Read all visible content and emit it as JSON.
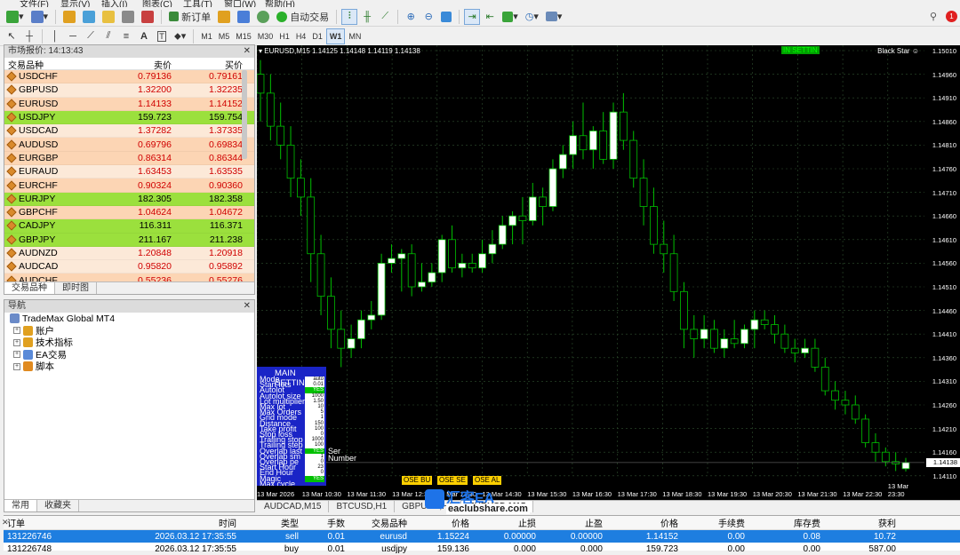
{
  "menu": [
    "文件(F)",
    "显示(V)",
    "插入(I)",
    "图表(C)",
    "工具(T)",
    "窗口(W)",
    "帮助(H)"
  ],
  "toolbar": {
    "new_order": "新订单",
    "auto_trade": "自动交易",
    "timeframes": [
      "M1",
      "M5",
      "M15",
      "M30",
      "H1",
      "H4",
      "D1",
      "W1",
      "MN"
    ],
    "active_timeframe": "M15",
    "pressed_timeframe": "W1"
  },
  "market_watch": {
    "title": "市场报价: 14:13:43",
    "col_symbol": "交易品种",
    "col_bid": "卖价",
    "col_ask": "买价",
    "rows": [
      {
        "symbol": "USDCHF",
        "bid": "0.79136",
        "ask": "0.79161",
        "bg": "#fcd5b4"
      },
      {
        "symbol": "GBPUSD",
        "bid": "1.32200",
        "ask": "1.32235",
        "bg": "#fce9d8"
      },
      {
        "symbol": "EURUSD",
        "bid": "1.14133",
        "ask": "1.14152",
        "bg": "#fcd5b4"
      },
      {
        "symbol": "USDJPY",
        "bid": "159.723",
        "ask": "159.754",
        "bg": "#9be03d",
        "green": true
      },
      {
        "symbol": "USDCAD",
        "bid": "1.37282",
        "ask": "1.37335",
        "bg": "#fce9d8"
      },
      {
        "symbol": "AUDUSD",
        "bid": "0.69796",
        "ask": "0.69834",
        "bg": "#fcd5b4"
      },
      {
        "symbol": "EURGBP",
        "bid": "0.86314",
        "ask": "0.86344",
        "bg": "#fcd5b4"
      },
      {
        "symbol": "EURAUD",
        "bid": "1.63453",
        "ask": "1.63535",
        "bg": "#fce9d8"
      },
      {
        "symbol": "EURCHF",
        "bid": "0.90324",
        "ask": "0.90360",
        "bg": "#fcd5b4"
      },
      {
        "symbol": "EURJPY",
        "bid": "182.305",
        "ask": "182.358",
        "bg": "#9be03d",
        "green": true
      },
      {
        "symbol": "GBPCHF",
        "bid": "1.04624",
        "ask": "1.04672",
        "bg": "#fcd5b4"
      },
      {
        "symbol": "CADJPY",
        "bid": "116.311",
        "ask": "116.371",
        "bg": "#9be03d",
        "green": true
      },
      {
        "symbol": "GBPJPY",
        "bid": "211.167",
        "ask": "211.238",
        "bg": "#9be03d",
        "green": true
      },
      {
        "symbol": "AUDNZD",
        "bid": "1.20848",
        "ask": "1.20918",
        "bg": "#fce9d8"
      },
      {
        "symbol": "AUDCAD",
        "bid": "0.95820",
        "ask": "0.95892",
        "bg": "#fce9d8"
      },
      {
        "symbol": "AUDCHF",
        "bid": "0.55236",
        "ask": "0.55276",
        "bg": "#fcd5b4"
      }
    ],
    "tabs": [
      "交易品种",
      "即时图"
    ]
  },
  "navigator": {
    "title": "导航",
    "root": "TradeMax Global MT4",
    "items": [
      "账户",
      "技术指标",
      "EA交易",
      "脚本"
    ],
    "tabs": [
      "常用",
      "收藏夹"
    ]
  },
  "chart": {
    "title": "EURUSD,M15  1.14125 1.14148 1.14119 1.14138",
    "indicator": "Black Star",
    "in_setting": "IN SETTIN",
    "price_labels": [
      "1.15010",
      "1.14960",
      "1.14910",
      "1.14860",
      "1.14810",
      "1.14760",
      "1.14710",
      "1.14660",
      "1.14610",
      "1.14560",
      "1.14510",
      "1.14460",
      "1.14410",
      "1.14360",
      "1.14310",
      "1.14260",
      "1.14210",
      "1.14160",
      "1.14110"
    ],
    "current_price": "1.14138",
    "time_labels": [
      "13 Mar 2026",
      "13 Mar 10:30",
      "13 Mar 11:30",
      "13 Mar 12:30",
      "13 Mar 13:30",
      "13 Mar 14:30",
      "13 Mar 15:30",
      "13 Mar 16:30",
      "13 Mar 17:30",
      "13 Mar 18:30",
      "13 Mar 19:30",
      "13 Mar 20:30",
      "13 Mar 21:30",
      "13 Mar 22:30",
      "13 Mar 23:30"
    ],
    "colors": {
      "bull": "#ffffff",
      "bear": "#000000",
      "wick": "#00c000",
      "grid": "#1a3a1a"
    },
    "candles": [
      [
        1.1496,
        1.1499,
        1.1486,
        1.1492
      ],
      [
        1.1492,
        1.1496,
        1.1482,
        1.1485
      ],
      [
        1.1485,
        1.149,
        1.1478,
        1.1481
      ],
      [
        1.1481,
        1.1485,
        1.147,
        1.1474
      ],
      [
        1.1474,
        1.1478,
        1.1466,
        1.147
      ],
      [
        1.147,
        1.1474,
        1.1452,
        1.1458
      ],
      [
        1.1458,
        1.1462,
        1.1445,
        1.1449
      ],
      [
        1.1449,
        1.1453,
        1.1438,
        1.1442
      ],
      [
        1.1442,
        1.1446,
        1.1434,
        1.1438
      ],
      [
        1.1438,
        1.1443,
        1.1436,
        1.144
      ],
      [
        1.144,
        1.1446,
        1.1438,
        1.1444
      ],
      [
        1.1444,
        1.1448,
        1.1442,
        1.1445
      ],
      [
        1.1445,
        1.1458,
        1.1444,
        1.1456
      ],
      [
        1.1456,
        1.146,
        1.1454,
        1.1457
      ],
      [
        1.1457,
        1.1459,
        1.145,
        1.1458
      ],
      [
        1.1458,
        1.146,
        1.1449,
        1.1451
      ],
      [
        1.1451,
        1.1456,
        1.145,
        1.1452
      ],
      [
        1.1452,
        1.1456,
        1.1451,
        1.1454
      ],
      [
        1.1454,
        1.1462,
        1.1452,
        1.1461
      ],
      [
        1.1461,
        1.1464,
        1.1454,
        1.1455
      ],
      [
        1.1455,
        1.1458,
        1.1453,
        1.1456
      ],
      [
        1.1456,
        1.1458,
        1.1454,
        1.1455
      ],
      [
        1.1455,
        1.1461,
        1.1454,
        1.1458
      ],
      [
        1.1458,
        1.1463,
        1.1456,
        1.146
      ],
      [
        1.146,
        1.1466,
        1.1459,
        1.1464
      ],
      [
        1.1464,
        1.1467,
        1.146,
        1.1466
      ],
      [
        1.1466,
        1.147,
        1.146,
        1.1465
      ],
      [
        1.1465,
        1.1473,
        1.1464,
        1.147
      ],
      [
        1.147,
        1.1472,
        1.1464,
        1.1468
      ],
      [
        1.1468,
        1.1478,
        1.1467,
        1.1476
      ],
      [
        1.1476,
        1.1481,
        1.1474,
        1.1479
      ],
      [
        1.1479,
        1.1486,
        1.1476,
        1.1483
      ],
      [
        1.1483,
        1.149,
        1.1478,
        1.148
      ],
      [
        1.148,
        1.1485,
        1.1476,
        1.1484
      ],
      [
        1.1484,
        1.1488,
        1.1477,
        1.1478
      ],
      [
        1.1478,
        1.149,
        1.1476,
        1.1488
      ],
      [
        1.1488,
        1.1492,
        1.148,
        1.1482
      ],
      [
        1.1482,
        1.1484,
        1.1472,
        1.1474
      ],
      [
        1.1474,
        1.1478,
        1.1464,
        1.1468
      ],
      [
        1.1468,
        1.1472,
        1.1458,
        1.146
      ],
      [
        1.146,
        1.1465,
        1.1454,
        1.1458
      ],
      [
        1.1458,
        1.1462,
        1.1448,
        1.145
      ],
      [
        1.145,
        1.1452,
        1.1438,
        1.1442
      ],
      [
        1.1442,
        1.1445,
        1.1436,
        1.144
      ],
      [
        1.144,
        1.1445,
        1.1438,
        1.1442
      ],
      [
        1.1442,
        1.1444,
        1.1437,
        1.1438
      ],
      [
        1.1438,
        1.1442,
        1.1436,
        1.144
      ],
      [
        1.144,
        1.1444,
        1.1438,
        1.1439
      ],
      [
        1.1439,
        1.1443,
        1.1438,
        1.1442
      ],
      [
        1.1442,
        1.1446,
        1.1438,
        1.1444
      ],
      [
        1.1444,
        1.1446,
        1.1442,
        1.1443
      ],
      [
        1.1443,
        1.1445,
        1.1439,
        1.1441
      ],
      [
        1.1441,
        1.1443,
        1.1437,
        1.1438
      ],
      [
        1.1438,
        1.144,
        1.1435,
        1.1437
      ],
      [
        1.1437,
        1.144,
        1.1436,
        1.1438
      ],
      [
        1.1438,
        1.144,
        1.1433,
        1.1434
      ],
      [
        1.1434,
        1.1436,
        1.1428,
        1.1429
      ],
      [
        1.1429,
        1.1431,
        1.1425,
        1.1427
      ],
      [
        1.1427,
        1.1429,
        1.1424,
        1.1426
      ],
      [
        1.1426,
        1.1428,
        1.1422,
        1.1423
      ],
      [
        1.1423,
        1.1424,
        1.1417,
        1.1418
      ],
      [
        1.1418,
        1.142,
        1.1414,
        1.1416
      ],
      [
        1.1416,
        1.1417,
        1.1413,
        1.1414
      ],
      [
        1.1414,
        1.1416,
        1.1412,
        1.14135
      ],
      [
        1.14125,
        1.14148,
        1.14119,
        1.14138
      ]
    ]
  },
  "ea_panel": {
    "heading": "MAIN SETTINGS",
    "rows": [
      {
        "label": "Mode",
        "value": "auto",
        "green": false
      },
      {
        "label": "Start lots",
        "value": "0.01",
        "green": false
      },
      {
        "label": "Autolot",
        "value": "YES",
        "green": true
      },
      {
        "label": "Autolot size",
        "value": "1000",
        "green": false
      },
      {
        "label": "Lot multiplier",
        "value": "1.50",
        "green": false
      },
      {
        "label": "Max lot",
        "value": "10",
        "green": false
      },
      {
        "label": "Max Orders",
        "value": "5",
        "green": false
      },
      {
        "label": "Grid mode",
        "value": "1",
        "green": false
      },
      {
        "label": "Distance",
        "value": "150",
        "green": false
      },
      {
        "label": "Take profit",
        "value": "100",
        "green": false
      },
      {
        "label": "Stop loss",
        "value": "0",
        "green": false
      },
      {
        "label": "Trailing stop",
        "value": "1000",
        "green": false
      },
      {
        "label": "Trailing step",
        "value": "100",
        "green": false
      },
      {
        "label": "Overlap last",
        "value": "YES",
        "green": true
      },
      {
        "label": "Overlap sm",
        "value": "1",
        "green": false
      },
      {
        "label": "Overlap pe",
        "value": "0",
        "green": false
      },
      {
        "label": "Start Hour",
        "value": "23",
        "green": false
      },
      {
        "label": "End Hour",
        "value": "0",
        "green": false
      },
      {
        "label": "Magic",
        "value": "YES",
        "green": true
      },
      {
        "label": "Max cycle",
        "value": "",
        "green": false
      }
    ],
    "overlap_text_1": "Ser",
    "overlap_text_2": "Number",
    "buttons": [
      "OSE BU",
      "OSE SE",
      "OSE AL"
    ]
  },
  "chart_tabs": [
    "AUDCAD,M15",
    "BTCUSD,H1",
    "GBPUSD,H1",
    "EURUSD,M15"
  ],
  "watermark": {
    "cn": "汇客EA",
    "en": "eaclubshare.com"
  },
  "terminal": {
    "headers": [
      "订单",
      "时间",
      "类型",
      "手数",
      "交易品种",
      "价格",
      "止损",
      "止盈",
      "价格",
      "手续费",
      "库存费",
      "获利"
    ],
    "rows": [
      {
        "order": "131226746",
        "time": "2026.03.12 17:35:55",
        "type": "sell",
        "lots": "0.01",
        "symbol": "eurusd",
        "price": "1.15224",
        "sl": "0.00000",
        "tp": "0.00000",
        "cur": "1.14152",
        "comm": "0.00",
        "swap": "0.08",
        "profit": "10.72",
        "selected": true
      },
      {
        "order": "131226748",
        "time": "2026.03.12 17:35:55",
        "type": "buy",
        "lots": "0.01",
        "symbol": "usdjpy",
        "price": "159.136",
        "sl": "0.000",
        "tp": "0.000",
        "cur": "159.723",
        "comm": "0.00",
        "swap": "0.00",
        "profit": "587.00",
        "selected": false
      }
    ]
  }
}
